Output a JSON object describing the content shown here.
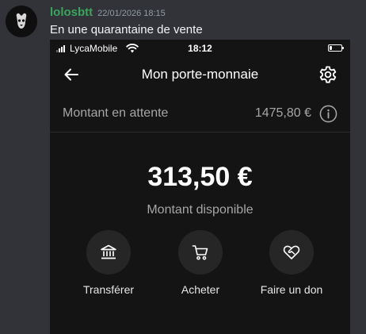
{
  "message": {
    "author": "lolosbtt",
    "timestamp": "22/01/2026 18:15",
    "text": "En une quarantaine de vente",
    "username_color": "#3ba55c"
  },
  "phone": {
    "status_bar": {
      "carrier": "LycaMobile",
      "time": "18:12",
      "battery_level": 0.2,
      "icons": [
        "signal-icon",
        "wifi-icon",
        "battery-icon"
      ]
    },
    "nav": {
      "title": "Mon porte-monnaie",
      "back_icon": "arrow-left-icon",
      "settings_icon": "gear-icon"
    },
    "pending": {
      "label": "Montant en attente",
      "amount": "1475,80 €",
      "info_icon": "info-icon"
    },
    "balance": {
      "amount": "313,50 €",
      "label": "Montant disponible"
    },
    "actions": [
      {
        "label": "Transférer",
        "icon": "bank-icon"
      },
      {
        "label": "Acheter",
        "icon": "cart-icon"
      },
      {
        "label": "Faire un don",
        "icon": "heart-handshake-icon"
      }
    ]
  }
}
